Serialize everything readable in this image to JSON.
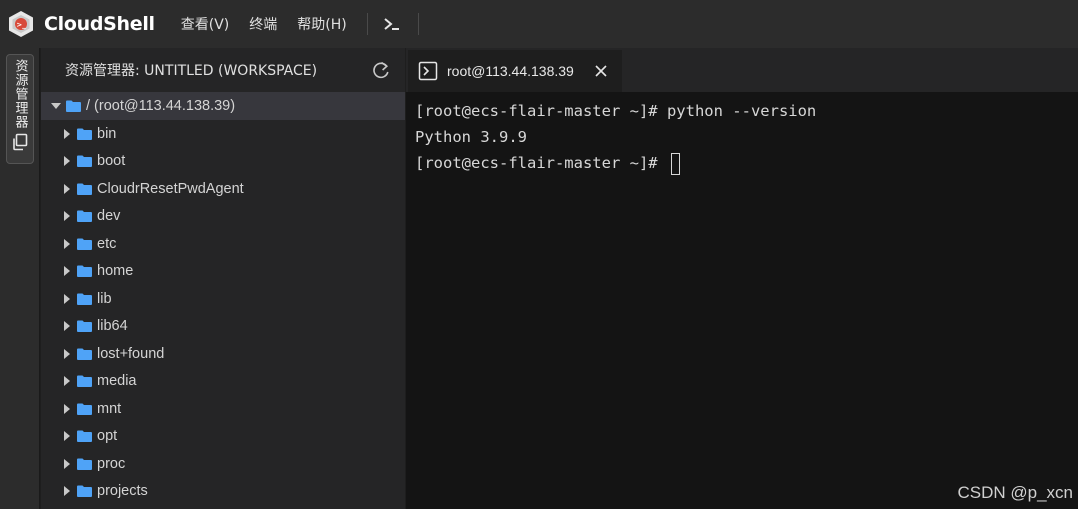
{
  "app": {
    "brand": "CloudShell",
    "logo_icon": "cloudshell-logo-icon"
  },
  "menu": {
    "items": [
      {
        "label": "查看(V)"
      },
      {
        "label": "终端"
      },
      {
        "label": "帮助(H)"
      }
    ],
    "terminal_icon": "terminal-prompt-icon"
  },
  "activity_bar": {
    "explorer_label": "资源管理器",
    "explorer_icon": "copy-files-icon"
  },
  "explorer": {
    "title": "资源管理器: UNTITLED (WORKSPACE)",
    "refresh_icon": "refresh-icon",
    "root_label": "/ (root@113.44.138.39)",
    "folders": [
      {
        "label": "bin"
      },
      {
        "label": "boot"
      },
      {
        "label": "CloudrResetPwdAgent"
      },
      {
        "label": "dev"
      },
      {
        "label": "etc"
      },
      {
        "label": "home"
      },
      {
        "label": "lib"
      },
      {
        "label": "lib64"
      },
      {
        "label": "lost+found"
      },
      {
        "label": "media"
      },
      {
        "label": "mnt"
      },
      {
        "label": "opt"
      },
      {
        "label": "proc"
      },
      {
        "label": "projects"
      }
    ]
  },
  "terminal": {
    "tab_label": "root@113.44.138.39",
    "lines": [
      "[root@ecs-flair-master ~]# python --version",
      "Python 3.9.9",
      "[root@ecs-flair-master ~]# "
    ]
  },
  "watermark": "CSDN @p_xcn",
  "colors": {
    "folder": "#4fa3f7",
    "background": "#1e1e1e",
    "terminal_bg": "#141414"
  }
}
